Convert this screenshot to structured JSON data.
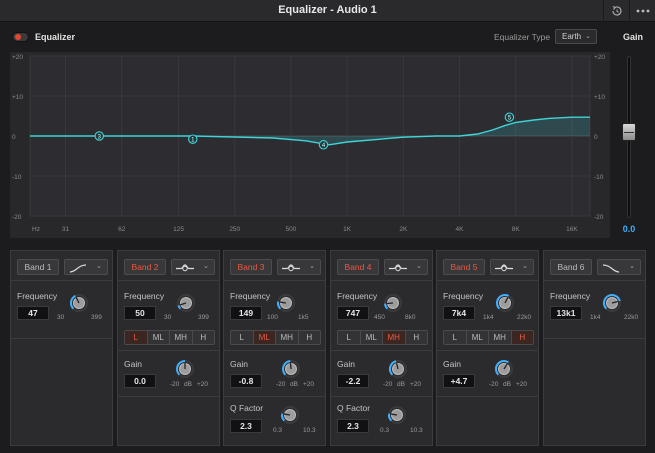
{
  "window": {
    "title": "Equalizer - Audio 1"
  },
  "header": {
    "eq_label": "Equalizer",
    "eq_type_label": "Equalizer Type",
    "eq_type_value": "Earth",
    "gain_label": "Gain"
  },
  "graph": {
    "y_labels_left": [
      "+20",
      "+10",
      "0",
      "-10",
      "-20"
    ],
    "y_labels_right": [
      "+20",
      "+10",
      "0",
      "-10",
      "-20"
    ],
    "x_labels": [
      "Hz",
      "31",
      "62",
      "125",
      "250",
      "500",
      "1K",
      "2K",
      "4K",
      "8K",
      "16K"
    ],
    "curve_color": "#3fd4d8",
    "curve_points": [
      [
        20,
        0
      ],
      [
        150,
        0
      ],
      [
        400,
        -0.5
      ],
      [
        600,
        -1.2
      ],
      [
        800,
        -2.2
      ],
      [
        1000,
        -1.5
      ],
      [
        2000,
        -0.3
      ],
      [
        3000,
        0
      ],
      [
        4000,
        0
      ],
      [
        5000,
        0.5
      ],
      [
        6000,
        1.5
      ],
      [
        7000,
        2.6
      ],
      [
        8000,
        3.4
      ],
      [
        10000,
        4.0
      ],
      [
        12000,
        4.4
      ],
      [
        16000,
        4.7
      ],
      [
        20000,
        4.7
      ]
    ],
    "nodes": [
      {
        "label": "3",
        "freq": 47,
        "gain": 0
      },
      {
        "label": "1",
        "freq": 149,
        "gain": -0.8
      },
      {
        "label": "4",
        "freq": 747,
        "gain": -2.2
      },
      {
        "label": "5",
        "freq": 7400,
        "gain": 4.7
      }
    ]
  },
  "gain": {
    "value": "0.0",
    "level_db": 0
  },
  "bands": [
    {
      "label": "Band 1",
      "active": false,
      "filter": "high-shelf-icon",
      "freq_label": "Frequency",
      "freq": "47",
      "freq_min": "30",
      "freq_max": "399",
      "freq_knob": 0.4
    },
    {
      "label": "Band 2",
      "active": true,
      "filter": "bell-icon",
      "freq_label": "Frequency",
      "freq": "50",
      "freq_min": "30",
      "freq_max": "399",
      "freq_knob": 0.1,
      "q_options": [
        "L",
        "ML",
        "MH",
        "H"
      ],
      "q_active": "L",
      "gain_label": "Gain",
      "gain": "0.0",
      "gain_min": "-20",
      "gain_unit": "dB",
      "gain_max": "+20",
      "gain_knob": 0.5
    },
    {
      "label": "Band 3",
      "active": true,
      "filter": "bell-icon",
      "freq_label": "Frequency",
      "freq": "149",
      "freq_min": "100",
      "freq_max": "1k5",
      "freq_knob": 0.2,
      "q_options": [
        "L",
        "ML",
        "MH",
        "H"
      ],
      "q_active": "ML",
      "gain_label": "Gain",
      "gain": "-0.8",
      "gain_min": "-20",
      "gain_unit": "dB",
      "gain_max": "+20",
      "gain_knob": 0.48,
      "qf_label": "Q Factor",
      "qf": "2.3",
      "qf_min": "0.3",
      "qf_max": "10.3",
      "qf_knob": 0.2
    },
    {
      "label": "Band 4",
      "active": true,
      "filter": "bell-icon",
      "freq_label": "Frequency",
      "freq": "747",
      "freq_min": "450",
      "freq_max": "8k0",
      "freq_knob": 0.15,
      "q_options": [
        "L",
        "ML",
        "MH",
        "H"
      ],
      "q_active": "MH",
      "gain_label": "Gain",
      "gain": "-2.2",
      "gain_min": "-20",
      "gain_unit": "dB",
      "gain_max": "+20",
      "gain_knob": 0.45,
      "qf_label": "Q Factor",
      "qf": "2.3",
      "qf_min": "0.3",
      "qf_max": "10.3",
      "qf_knob": 0.2
    },
    {
      "label": "Band 5",
      "active": true,
      "filter": "bell-icon",
      "freq_label": "Frequency",
      "freq": "7k4",
      "freq_min": "1k4",
      "freq_max": "22k0",
      "freq_knob": 0.6,
      "q_options": [
        "L",
        "ML",
        "MH",
        "H"
      ],
      "q_active": "H",
      "gain_label": "Gain",
      "gain": "+4.7",
      "gain_min": "-20",
      "gain_unit": "dB",
      "gain_max": "+20",
      "gain_knob": 0.62
    },
    {
      "label": "Band 6",
      "active": false,
      "filter": "low-shelf-icon",
      "freq_label": "Frequency",
      "freq": "13k1",
      "freq_min": "1k4",
      "freq_max": "22k0",
      "freq_knob": 0.78
    }
  ]
}
